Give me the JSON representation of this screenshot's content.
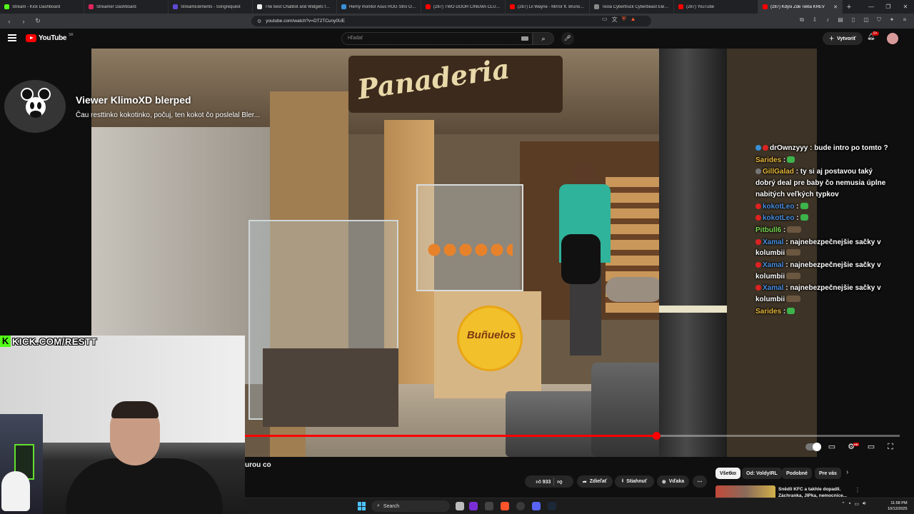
{
  "browser": {
    "tabs": [
      {
        "label": "Stream - Kick Dashboard",
        "color": "#53fc18",
        "active": false
      },
      {
        "label": "Streamer Dashboard",
        "color": "#e0245e",
        "active": false
      },
      {
        "label": "StreamElements - Songrequest",
        "color": "#5b4bd6",
        "active": false
      },
      {
        "label": "The best ChatBot and Widgets for ...",
        "color": "#eeeeee",
        "active": false
      },
      {
        "label": "Herný monitor Asus ROG Strix OLED ...",
        "color": "#3a8fd6",
        "active": false
      },
      {
        "label": "(287) TWO DOOR CINEMA CLUB | ...",
        "color": "#ff0000",
        "active": false
      },
      {
        "label": "(287) Lil Wayne - Mirror ft. Bruno M...",
        "color": "#ff0000",
        "active": false
      },
      {
        "label": "Tesla Cybertruck Cyberbeast Electri...",
        "color": "#888888",
        "active": false
      },
      {
        "label": "(287) YouTube",
        "color": "#ff0000",
        "active": false
      },
      {
        "label": "(287) Kdysi Zde Tekla KREV",
        "color": "#ff0000",
        "active": true
      }
    ],
    "url": "youtube.com/watch?v=DT2TCuny0UE",
    "new_tab": "+",
    "window_controls": [
      "—",
      "❐",
      "✕"
    ]
  },
  "youtube": {
    "logo_text": "YouTube",
    "country": "SK",
    "search_placeholder": "Hľadať",
    "create_label": "Vytvoriť",
    "notifications": "9+"
  },
  "alert": {
    "title": "Viewer KlimoXD blerped",
    "message": "Čau resttinko kokotinko, počuj, ten kokot čo poslelal Bler..."
  },
  "chat": [
    {
      "badges": [
        "blue",
        "red"
      ],
      "user": "drOwnzyyy",
      "user_color": "#ffffff",
      "text": ": bude intro po tomto ?",
      "emote": ""
    },
    {
      "badges": [],
      "user": "Sarides",
      "user_color": "#e8b93a",
      "text": ":",
      "emote": "green"
    },
    {
      "badges": [
        "gray"
      ],
      "user": "GillGalad",
      "user_color": "#e8b93a",
      "text": ": ty si aj postavou taký dobrý deal pre baby čo nemusia úplne nabitých veľkých typkov",
      "emote": ""
    },
    {
      "badges": [
        "red"
      ],
      "user": "kokotLeo",
      "user_color": "#4a90e2",
      "text": ":",
      "emote": "green"
    },
    {
      "badges": [
        "red"
      ],
      "user": "kokotLeo",
      "user_color": "#4a90e2",
      "text": ":",
      "emote": "green"
    },
    {
      "badges": [],
      "user": "Pitbull6",
      "user_color": "#7ed957",
      "text": ":",
      "emote": "brown"
    },
    {
      "badges": [
        "red"
      ],
      "user": "Xamal",
      "user_color": "#4a90e2",
      "text": ": najnebezpečnejšie sačky v kolumbii",
      "emote": "brown"
    },
    {
      "badges": [
        "red"
      ],
      "user": "Xamal",
      "user_color": "#4a90e2",
      "text": ": najnebezpečnejšie sačky v kolumbii",
      "emote": "brown"
    },
    {
      "badges": [
        "red"
      ],
      "user": "Xamal",
      "user_color": "#4a90e2",
      "text": ": najnebezpečnejšie sačky v kolumbii",
      "emote": "brown"
    },
    {
      "badges": [],
      "user": "Sarides",
      "user_color": "#e8b93a",
      "text": ":",
      "emote": "green"
    }
  ],
  "scene": {
    "sign_text": "Panaderia",
    "bunuelos_text": "Buñuelos"
  },
  "overlay": {
    "kick_url": "KICK.COM/RESTT",
    "kick_logo": "K"
  },
  "player": {
    "progress": 0.628
  },
  "video": {
    "title_fragment": "urou co",
    "likes": "933",
    "share_label": "Zdieľať",
    "download_label": "Stiahnuť",
    "thanks_label": "Vďaka",
    "more_label": "⋯"
  },
  "chips": [
    "Všetko",
    "Od: VoldyIRL",
    "Podobné",
    "Pre vás"
  ],
  "recommendation": {
    "title": "Snědli KFC a takhle dopadli.",
    "subtitle": "Záchranka, JIPka, nemocnice..."
  },
  "taskbar": {
    "search_label": "Search",
    "time": "11:58 PM",
    "date": "10/12/2025"
  }
}
